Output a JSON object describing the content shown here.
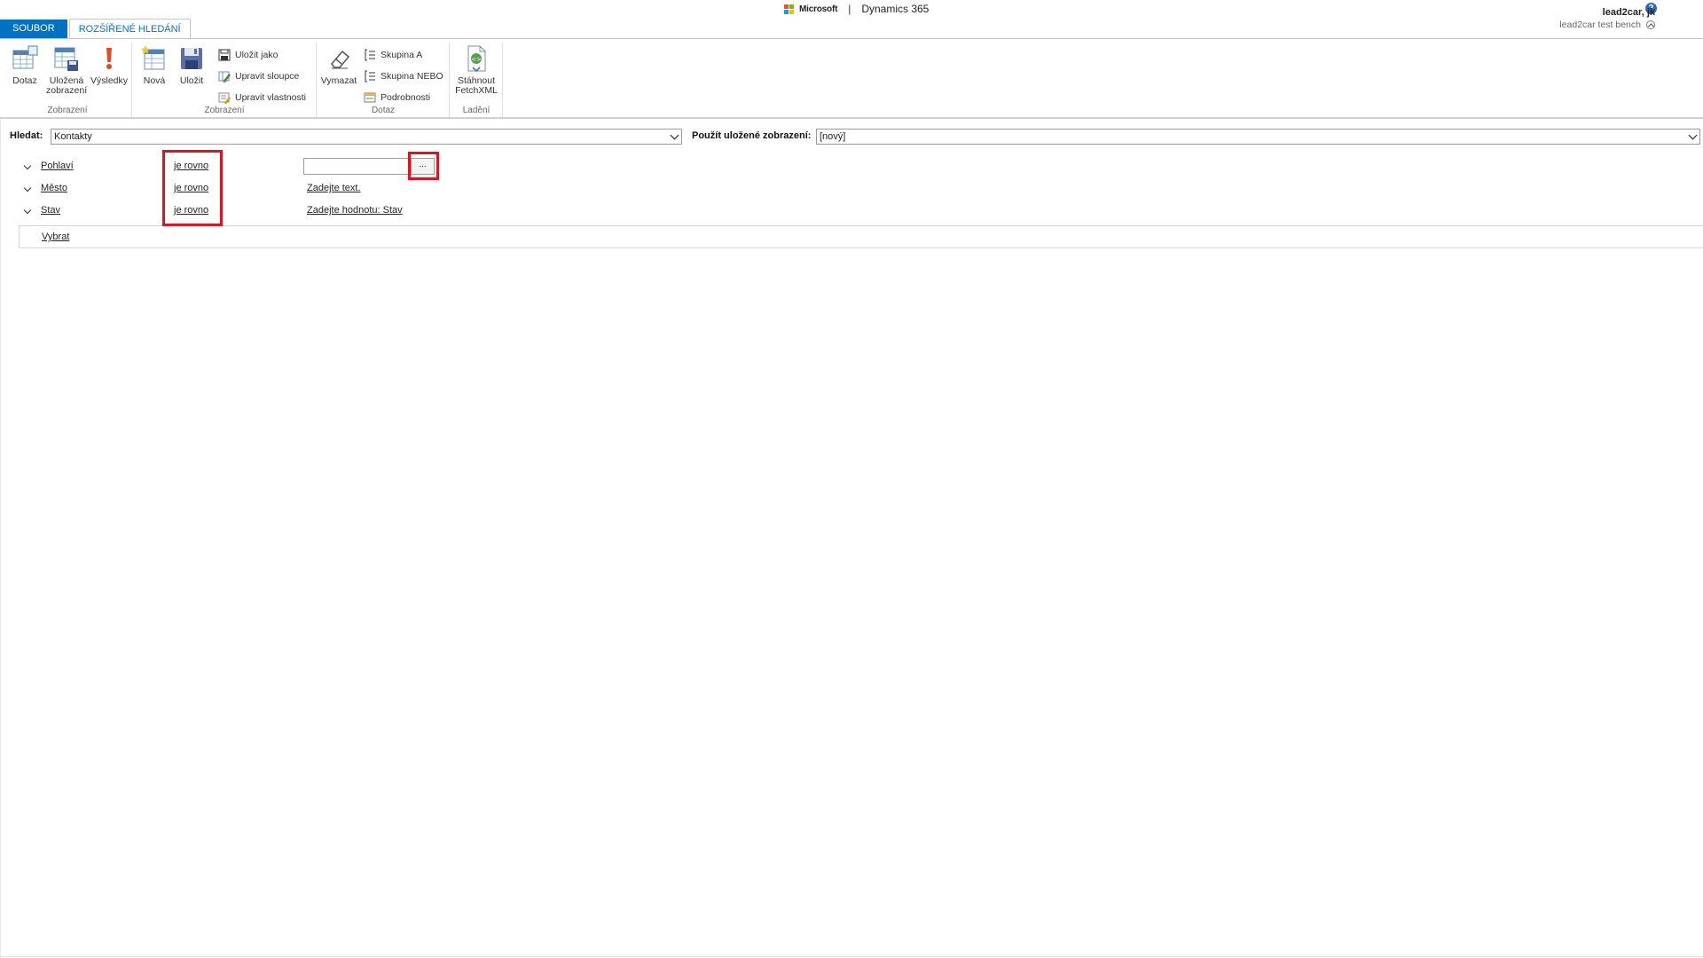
{
  "header": {
    "brand_ms": "Microsoft",
    "brand_sep": "|",
    "brand_product": "Dynamics 365",
    "user_name": "lead2car, jk",
    "org_name": "lead2car test bench",
    "help_glyph": "?"
  },
  "tabs": {
    "file": "SOUBOR",
    "advanced_find": "ROZŠÍŘENÉ HLEDÁNÍ"
  },
  "ribbon": {
    "groups": {
      "zobrazeni1": "Zobrazení",
      "zobrazeni2": "Zobrazení",
      "dotaz": "Dotaz",
      "ladeni": "Ladění"
    },
    "buttons": {
      "dotaz": "Dotaz",
      "ulozena_line1": "Uložená",
      "ulozena_line2": "zobrazení",
      "vysledky": "Výsledky",
      "nova": "Nová",
      "ulozit": "Uložit",
      "ulozit_jako": "Uložit jako",
      "upravit_sloupce": "Upravit sloupce",
      "upravit_vlastnosti": "Upravit vlastnosti",
      "vymazat": "Vymazat",
      "skupina_a": "Skupina A",
      "skupina_nebo": "Skupina NEBO",
      "podrobnosti": "Podrobnosti",
      "stahnout_line1": "Stáhnout",
      "stahnout_line2": "FetchXML"
    }
  },
  "search": {
    "find_label": "Hledat:",
    "find_value": "Kontakty",
    "saved_view_label": "Použít uložené zobrazení:",
    "saved_view_value": "[nový]"
  },
  "criteria": [
    {
      "field": "Pohlaví",
      "operator": "je rovno",
      "value": ""
    },
    {
      "field": "Město",
      "operator": "je rovno",
      "value": "Zadejte text."
    },
    {
      "field": "Stav",
      "operator": "je rovno",
      "value": "Zadejte hodnotu: Stav"
    }
  ],
  "lookup_button": "...",
  "select_link": "Vybrat",
  "colors": {
    "accent": "#0072c6",
    "highlight": "#e0121e"
  }
}
